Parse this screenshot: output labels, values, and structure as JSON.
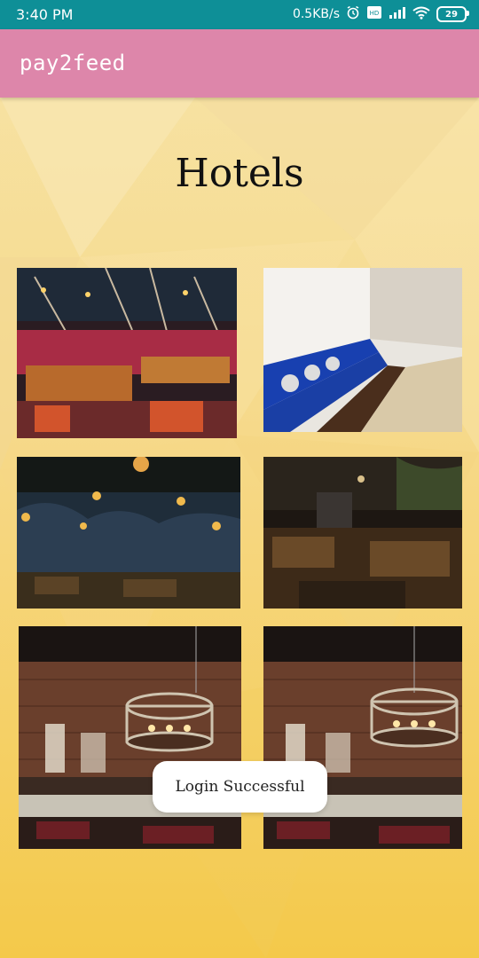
{
  "status_bar": {
    "time": "3:40 PM",
    "network_speed": "0.5KB/s",
    "battery_level": "29",
    "icons": [
      "alarm-icon",
      "volte-icon",
      "signal-icon",
      "wifi-icon",
      "battery-icon"
    ]
  },
  "app_bar": {
    "title": "pay2feed",
    "color": "#dd86aa"
  },
  "page": {
    "title": "Hotels"
  },
  "hotels": [
    {
      "image": "restaurant-interior-red-booths"
    },
    {
      "image": "restaurant-interior-blue-banquette"
    },
    {
      "image": "restaurant-interior-cave-lights"
    },
    {
      "image": "restaurant-interior-dark-wood"
    },
    {
      "image": "restaurant-interior-chandelier"
    },
    {
      "image": "restaurant-interior-chandelier"
    }
  ],
  "toast": {
    "message": "Login Successful"
  },
  "colors": {
    "status_bar": "#0e8f97",
    "background": "#f6d98a",
    "toast_bg": "#ffffff"
  }
}
